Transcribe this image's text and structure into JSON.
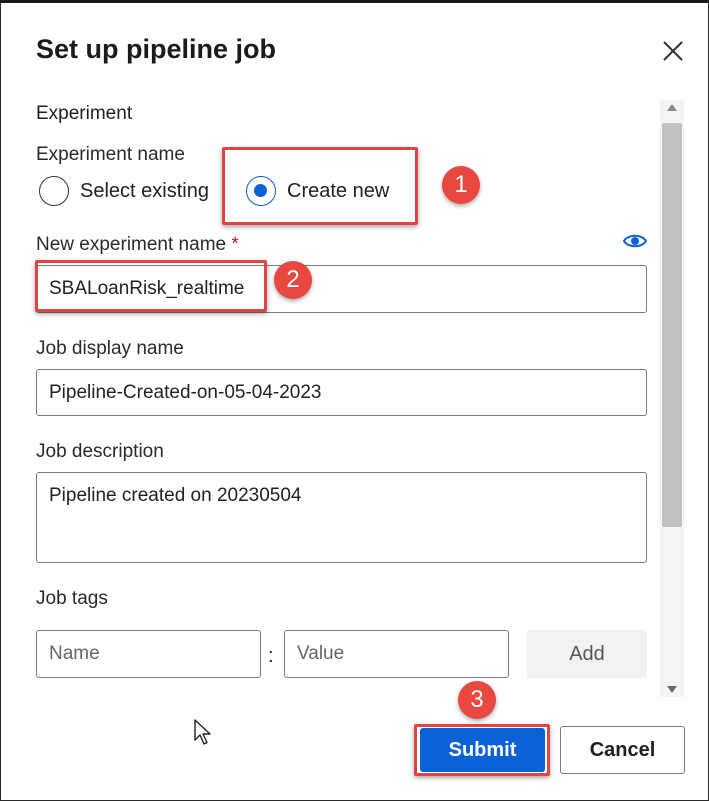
{
  "dialog": {
    "title": "Set up pipeline job",
    "close_icon": "close-icon"
  },
  "experiment": {
    "section_heading": "Experiment",
    "name_label": "Experiment name",
    "option_existing": "Select existing",
    "option_new": "Create new",
    "selected": "Create new",
    "new_name_label": "New experiment name",
    "required_marker": "*",
    "new_name_value": "SBALoanRisk_realtime",
    "visibility_icon": "eye-icon"
  },
  "job": {
    "display_name_label": "Job display name",
    "display_name_value": "Pipeline-Created-on-05-04-2023",
    "description_label": "Job description",
    "description_value": "Pipeline created on 20230504",
    "tags_label": "Job tags",
    "tag_name_placeholder": "Name",
    "tag_separator": ":",
    "tag_value_placeholder": "Value",
    "add_label": "Add"
  },
  "footer": {
    "submit_label": "Submit",
    "cancel_label": "Cancel"
  },
  "annotations": {
    "step1": "1",
    "step2": "2",
    "step3": "3",
    "color": "#e8483f"
  },
  "colors": {
    "primary": "#0b62d6",
    "required": "#a4262c"
  }
}
